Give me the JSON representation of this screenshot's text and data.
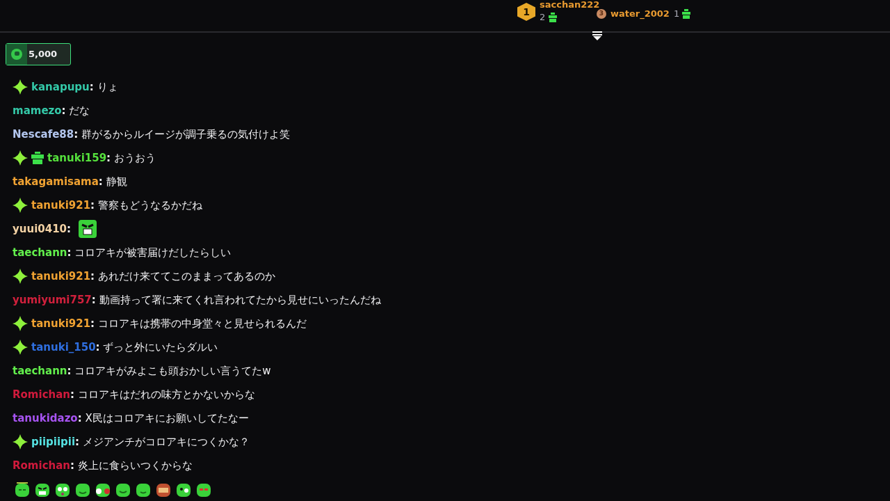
{
  "leaderboard": [
    {
      "rank": "1",
      "color": "#e8a828",
      "name": "sacchan222",
      "count": "2"
    },
    {
      "rank": "3",
      "color": "#c98a62",
      "name": "water_2002",
      "count": "1"
    }
  ],
  "points": {
    "value": "5,000"
  },
  "messages": [
    {
      "kind": "text",
      "user": "kanapupu",
      "color": "#34c9a8",
      "sparkle_badge": true,
      "text": "**:** りょ"
    },
    {
      "kind": "text",
      "user": "mamezo",
      "color": "#34c9a8",
      "text": "**:** だな"
    },
    {
      "kind": "text",
      "user": "Nescafe88",
      "color": "#b3c6ee",
      "text": "**:** 群がるからルイージが調子乗るの気付けよ笑"
    },
    {
      "kind": "text",
      "user": "tanuki159",
      "color": "#55e03c",
      "sparkle_badge": true,
      "gift_badge": true,
      "text": "**:** おうおう"
    },
    {
      "kind": "text",
      "user": "takagamisama",
      "color": "#f0a232",
      "text": "**:** 静観"
    },
    {
      "kind": "text",
      "user": "tanuki921",
      "color": "#f0a232",
      "sparkle_badge": true,
      "text": "**:** 警察もどうなるかだね"
    },
    {
      "kind": "emote",
      "user": "yuui0410",
      "color": "#f3d2a4",
      "text": "**:**"
    },
    {
      "kind": "text",
      "user": "taechann",
      "color": "#62ef4c",
      "text": "**:** コロアキが被害届けだしたらしい"
    },
    {
      "kind": "text",
      "user": "tanuki921",
      "color": "#f0a232",
      "sparkle_badge": true,
      "text": "**:** あれだけ来ててこのままってあるのか"
    },
    {
      "kind": "text",
      "user": "yumiyumi757",
      "color": "#d0203c",
      "text": "**:** 動画持って署に来てくれ言われてたから見せにいったんだね"
    },
    {
      "kind": "text",
      "user": "tanuki921",
      "color": "#f0a232",
      "sparkle_badge": true,
      "text": "**:** コロアキは携帯の中身堂々と見せられるんだ"
    },
    {
      "kind": "text",
      "user": "tanuki_150",
      "color": "#2f6fe0",
      "sparkle_badge": true,
      "text": "**:** ずっと外にいたらダルい"
    },
    {
      "kind": "text",
      "user": "taechann",
      "color": "#62ef4c",
      "text": "**:** コロアキがみよこも頭おかしい言うてたw"
    },
    {
      "kind": "text",
      "user": "Romichan",
      "color": "#d01a3c",
      "text": "**:** コロアキはだれの味方とかないからな"
    },
    {
      "kind": "text",
      "user": "tanukidazo",
      "color": "#a653f0",
      "text": "**:** X民はコロアキにお願いしてたなー"
    },
    {
      "kind": "text",
      "user": "piipiipii",
      "color": "#56e2e2",
      "sparkle_badge": true,
      "text": "**:** メジアンチがコロアキにつくかな？"
    },
    {
      "kind": "text",
      "user": "Romichan",
      "color": "#d01a3c",
      "text": "**:** 炎上に食らいつくからな"
    }
  ]
}
